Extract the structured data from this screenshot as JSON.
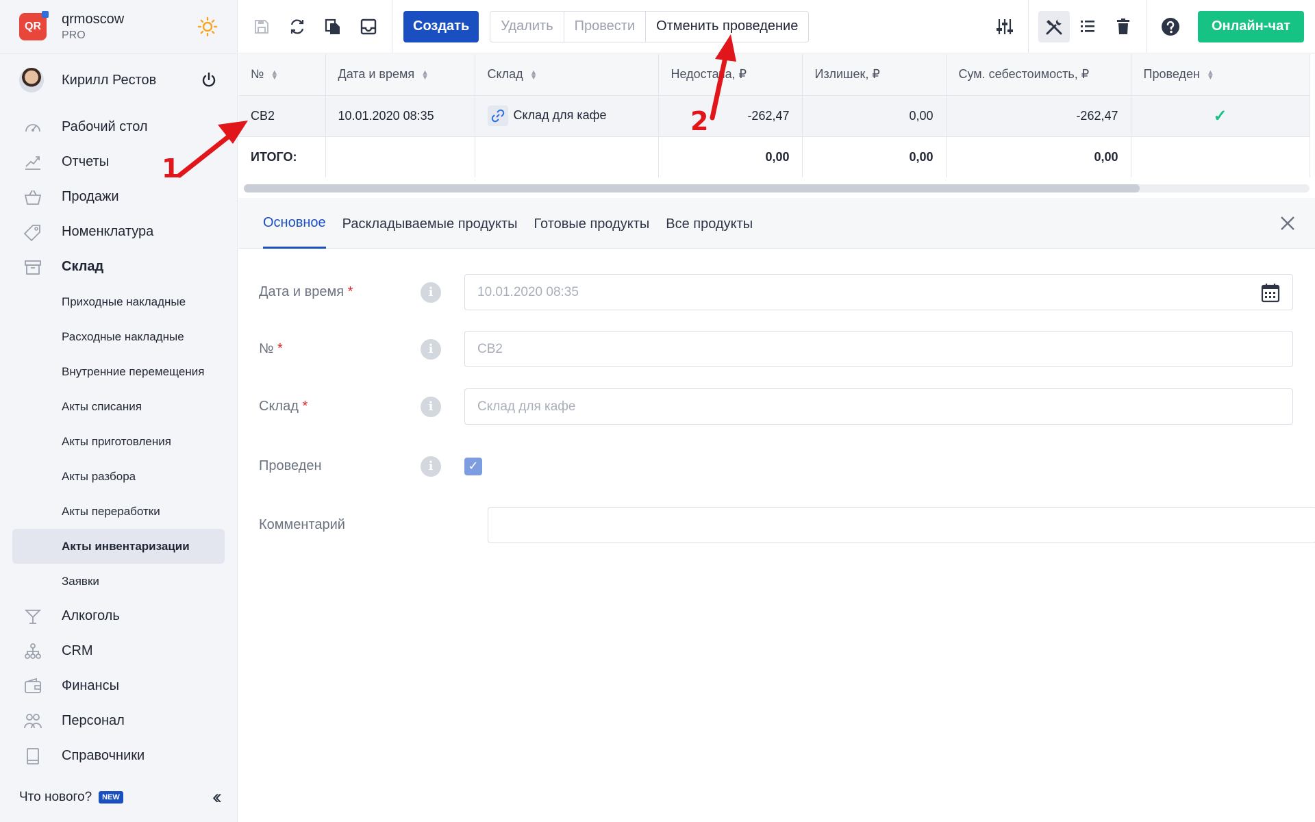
{
  "brand": {
    "name": "qrmoscow",
    "plan": "PRO",
    "logo_text": "QR"
  },
  "user": {
    "name": "Кирилл Рестов"
  },
  "nav": [
    {
      "label": "Рабочий стол",
      "icon": "dashboard-icon"
    },
    {
      "label": "Отчеты",
      "icon": "reports-icon"
    },
    {
      "label": "Продажи",
      "icon": "basket-icon"
    },
    {
      "label": "Номенклатура",
      "icon": "tag-icon"
    },
    {
      "label": "Склад",
      "icon": "warehouse-icon"
    }
  ],
  "warehouse_sub": [
    "Приходные накладные",
    "Расходные накладные",
    "Внутренние перемещения",
    "Акты списания",
    "Акты приготовления",
    "Акты разбора",
    "Акты переработки",
    "Акты инвентаризации",
    "Заявки"
  ],
  "nav_bottom": [
    {
      "label": "Алкоголь",
      "icon": "cocktail-icon"
    },
    {
      "label": "CRM",
      "icon": "hierarchy-icon"
    },
    {
      "label": "Финансы",
      "icon": "wallet-icon"
    },
    {
      "label": "Персонал",
      "icon": "people-icon"
    },
    {
      "label": "Справочники",
      "icon": "book-icon"
    }
  ],
  "whatsnew": {
    "label": "Что нового?",
    "badge": "NEW"
  },
  "toolbar": {
    "create_label": "Создать",
    "delete_label": "Удалить",
    "post_label": "Провести",
    "unpost_label": "Отменить проведение",
    "chat_label": "Онлайн-чат"
  },
  "table": {
    "headers": [
      "№",
      "Дата и время",
      "Склад",
      "Недостача, ₽",
      "Излишек, ₽",
      "Сум. себестоимость, ₽",
      "Проведен"
    ],
    "row": {
      "number": "СВ2",
      "datetime": "10.01.2020 08:35",
      "warehouse": "Склад для кафе",
      "shortage": "-262,47",
      "surplus": "0,00",
      "cost_sum": "-262,47",
      "posted": "✓"
    },
    "total": {
      "label": "ИТОГО:",
      "shortage": "0,00",
      "surplus": "0,00",
      "cost_sum": "0,00"
    }
  },
  "tabs": [
    "Основное",
    "Раскладываемые продукты",
    "Готовые продукты",
    "Все продукты"
  ],
  "form": {
    "datetime_label": "Дата и время",
    "datetime_value": "10.01.2020 08:35",
    "number_label": "№",
    "number_value": "СВ2",
    "warehouse_label": "Склад",
    "warehouse_value": "Склад для кафе",
    "posted_label": "Проведен",
    "comment_label": "Комментарий",
    "comment_value": "",
    "required_mark": "*",
    "info_glyph": "i"
  },
  "annotations": {
    "one": "1",
    "two": "2"
  },
  "colors": {
    "primary": "#1a4fc1",
    "chat": "#17c285",
    "annotation": "#e0161b",
    "logo": "#e8463b"
  }
}
